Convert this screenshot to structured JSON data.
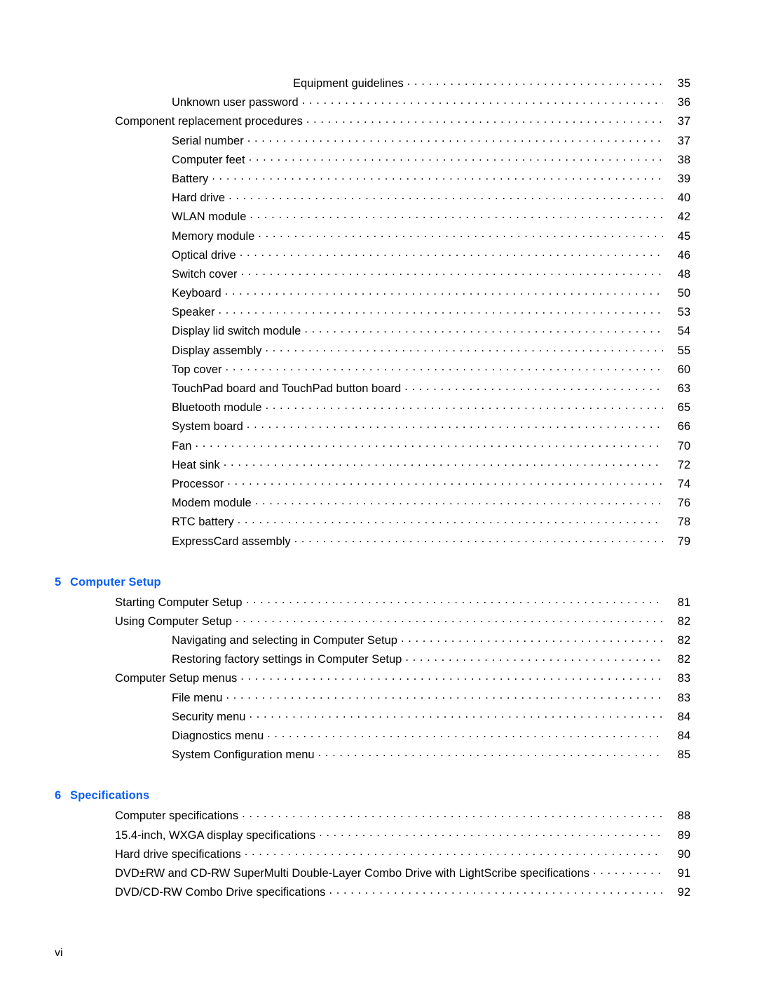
{
  "document": {
    "page_folio": "vi"
  },
  "toc": {
    "blocks": [
      {
        "type": "entries",
        "entries": [
          {
            "label": "Equipment guidelines",
            "page": "35",
            "level": 3
          },
          {
            "label": "Unknown user password",
            "page": "36",
            "level": 2
          },
          {
            "label": "Component replacement procedures",
            "page": "37",
            "level": 1
          },
          {
            "label": "Serial number",
            "page": "37",
            "level": 2
          },
          {
            "label": "Computer feet",
            "page": "38",
            "level": 2
          },
          {
            "label": "Battery",
            "page": "39",
            "level": 2
          },
          {
            "label": "Hard drive",
            "page": "40",
            "level": 2
          },
          {
            "label": "WLAN module",
            "page": "42",
            "level": 2
          },
          {
            "label": "Memory module",
            "page": "45",
            "level": 2
          },
          {
            "label": "Optical drive",
            "page": "46",
            "level": 2
          },
          {
            "label": "Switch cover",
            "page": "48",
            "level": 2
          },
          {
            "label": "Keyboard",
            "page": "50",
            "level": 2
          },
          {
            "label": "Speaker",
            "page": "53",
            "level": 2
          },
          {
            "label": "Display lid switch module",
            "page": "54",
            "level": 2
          },
          {
            "label": "Display assembly",
            "page": "55",
            "level": 2
          },
          {
            "label": "Top cover",
            "page": "60",
            "level": 2
          },
          {
            "label": "TouchPad board and TouchPad button board",
            "page": "63",
            "level": 2
          },
          {
            "label": "Bluetooth module",
            "page": "65",
            "level": 2
          },
          {
            "label": "System board",
            "page": "66",
            "level": 2
          },
          {
            "label": "Fan",
            "page": "70",
            "level": 2
          },
          {
            "label": "Heat sink",
            "page": "72",
            "level": 2
          },
          {
            "label": "Processor",
            "page": "74",
            "level": 2
          },
          {
            "label": "Modem module",
            "page": "76",
            "level": 2
          },
          {
            "label": "RTC battery",
            "page": "78",
            "level": 2
          },
          {
            "label": "ExpressCard assembly",
            "page": "79",
            "level": 2
          }
        ]
      },
      {
        "type": "chapter",
        "number": "5",
        "title": "Computer Setup",
        "entries": [
          {
            "label": "Starting Computer Setup",
            "page": "81",
            "level": 1
          },
          {
            "label": "Using Computer Setup",
            "page": "82",
            "level": 1
          },
          {
            "label": "Navigating and selecting in Computer Setup",
            "page": "82",
            "level": 2
          },
          {
            "label": "Restoring factory settings in Computer Setup",
            "page": "82",
            "level": 2
          },
          {
            "label": "Computer Setup menus",
            "page": "83",
            "level": 1
          },
          {
            "label": "File menu",
            "page": "83",
            "level": 2
          },
          {
            "label": "Security menu",
            "page": "84",
            "level": 2
          },
          {
            "label": "Diagnostics menu",
            "page": "84",
            "level": 2
          },
          {
            "label": "System Configuration menu",
            "page": "85",
            "level": 2
          }
        ]
      },
      {
        "type": "chapter",
        "number": "6",
        "title": "Specifications",
        "entries": [
          {
            "label": "Computer specifications",
            "page": "88",
            "level": 1
          },
          {
            "label": "15.4-inch, WXGA display specifications",
            "page": "89",
            "level": 1
          },
          {
            "label": "Hard drive specifications",
            "page": "90",
            "level": 1
          },
          {
            "label": "DVD±RW and CD-RW SuperMulti Double-Layer Combo Drive with LightScribe specifications",
            "page": "91",
            "level": 1
          },
          {
            "label": "DVD/CD-RW Combo Drive specifications",
            "page": "92",
            "level": 1
          }
        ]
      }
    ]
  },
  "theme": {
    "chapter_heading_color": "#0b5ef5",
    "body_text_color": "#000000",
    "page_background": "#ffffff"
  }
}
